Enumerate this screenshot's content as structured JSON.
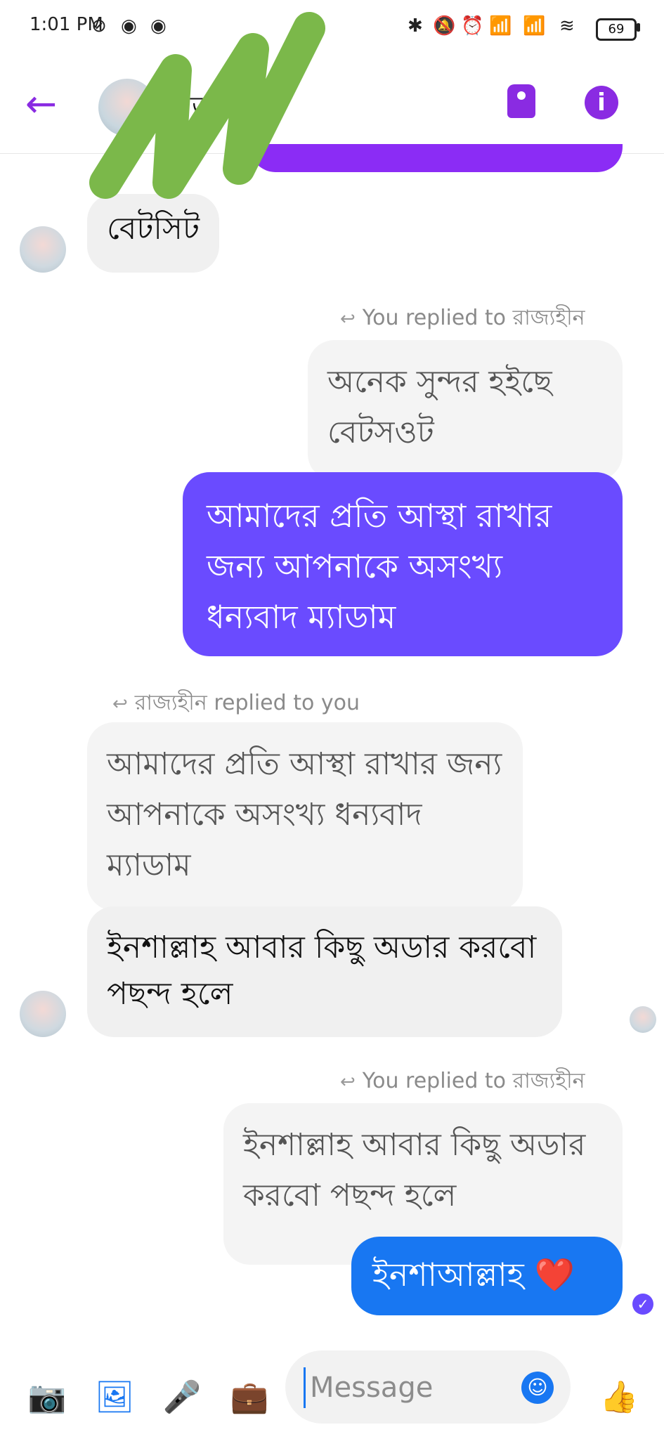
{
  "status_bar": {
    "time": "1:01 PM",
    "battery": "69"
  },
  "header": {
    "contact_name": "রাজ্যহীন"
  },
  "messages": {
    "m1": "বেটসিট",
    "m2_reply_note": "You replied to রাজ্যহীন",
    "m2_quote": "অনেক সুন্দর হইছে বেটসওট",
    "m2_text": "আমাদের প্রতি আস্থা রাখার জন্য আপনাকে অসংখ্য ধন্যবাদ ম্যাডাম",
    "m3_reply_note": "রাজ্যহীন replied to you",
    "m3_quote": "আমাদের প্রতি আস্থা রাখার জন্য আপনাকে অসংখ্য ধন্যবাদ ম্যাডাম",
    "m3_text": "ইনশাল্লাহ আবার কিছু অডার করবো পছন্দ হলে",
    "m4_reply_note": "You replied to রাজ্যহীন",
    "m4_quote": "ইনশাল্লাহ আবার কিছু অডার করবো পছন্দ হলে",
    "m4_text": "ইনশাআল্লাহ ❤️"
  },
  "composer": {
    "placeholder": "Message"
  },
  "icons": {
    "back": "arrow-left-icon",
    "tag": "tag-icon",
    "info": "info-icon",
    "camera": "camera-icon",
    "gallery": "image-icon",
    "mic": "microphone-icon",
    "briefcase": "briefcase-icon",
    "emoji": "emoji-icon",
    "like": "thumbs-up-icon"
  },
  "colors": {
    "accent_purple": "#8a2be2",
    "out_purple": "#6a4bff",
    "out_blue": "#1877f2",
    "in_gray": "#f0f0f0",
    "scribble_green": "#7bb84a"
  }
}
